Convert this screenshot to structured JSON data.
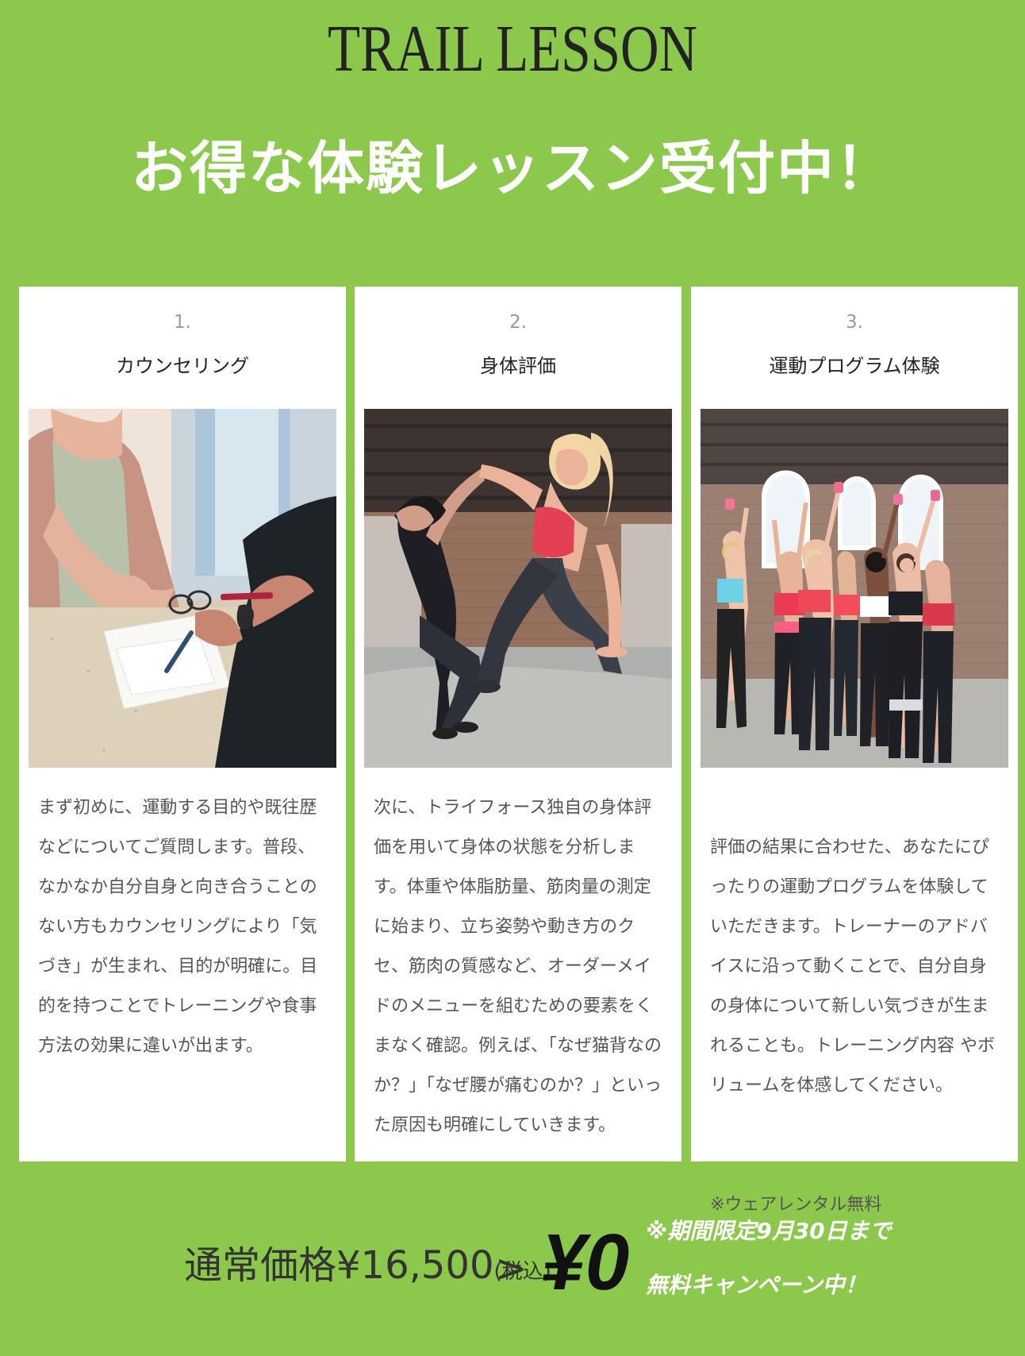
{
  "header": {
    "title": "TRAIL LESSON",
    "headline": "お得な体験レッスン受付中！"
  },
  "steps": [
    {
      "number": "1.",
      "title": "カウンセリング",
      "image": "counseling-photo",
      "text": "まず初めに、運動する目的や既往歴などについてご質問します。普段、なかなか自分自身と向き合うことのない方もカウンセリングにより「気づき」が生まれ、目的が明確に。目的を持つことでトレーニングや食事方法の効果に違いが出ます。"
    },
    {
      "number": "2.",
      "title": "身体評価",
      "image": "assessment-photo",
      "text": "次に、トライフォース独自の身体評価を用いて身体の状態を分析します。体重や体脂肪量、筋肉量の測定に始まり、立ち姿勢や動き方のクセ、筋肉の質感など、オーダーメイドのメニューを組むための要素をくまなく確認。例えば、「なぜ猫背なのか？」「なぜ腰が痛むのか？」といった原因も明確にしていきます。"
    },
    {
      "number": "3.",
      "title": "運動プログラム体験",
      "image": "group-workout-photo",
      "text": "評価の結果に合わせた、あなたにぴったりの運動プログラムを体験していただきます。トレーナーのアドバイスに沿って動くことで、自分自身の身体について新しい気づきが生まれることも。トレーニング内容 やボリュームを体感してください。",
      "note": "※ウェアレンタル無料"
    }
  ],
  "pricing": {
    "regular_label": "通常価格¥16,500",
    "tax_label": "(税込)",
    "arrow": ">",
    "campaign_price": "¥0",
    "period": "※期間限定9月30日まで",
    "campaign": "無料キャンペーン中！"
  },
  "colors": {
    "background": "#8cc84b",
    "card": "#ffffff",
    "headline": "#ffffff"
  }
}
